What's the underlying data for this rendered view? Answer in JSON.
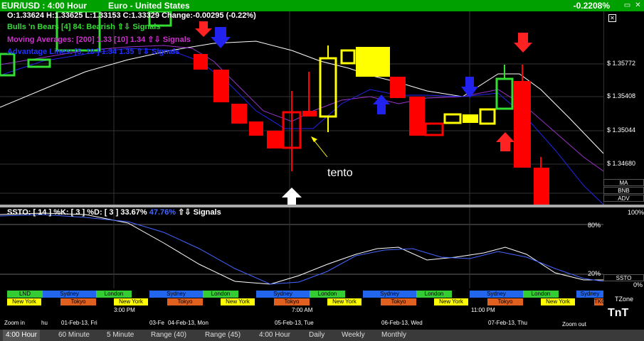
{
  "title": {
    "symbol": "EUR/USD : 4:00 Hour",
    "name": "Euro - United States",
    "change_pct": "-0.2208%"
  },
  "legend": {
    "ohlc": "O:1.33624  H:1.33625  L:1.33153  C:1.33329  Change:-0.00295 (-0.22%)",
    "bulls": "Bulls 'n Bears [4] 84:  Bearish  ⇧⇩ Signals",
    "ma": "Moving Averages: [200] 1.33  [10] 1.34  ⇧⇩ Signals",
    "adv": "Advantage Lines: [5,  10  ]  1.34  1.35  ⇧⇩ Signals"
  },
  "annotation": "tento",
  "price_ticks": [
    "$ 1.35772",
    "$ 1.35408",
    "$ 1.35044",
    "$ 1.34680"
  ],
  "side_buttons": [
    "MA",
    "BNB",
    "ADV"
  ],
  "stoch": {
    "label": "SSTO: [ 14 ] %K: [ 3 ] %D: [ 3 ]",
    "k_val": "33.67%",
    "d_val": "47.76%",
    "signals": "⇧⇩ Signals",
    "ticks": [
      "80%",
      "20%"
    ],
    "axis": [
      "100%",
      "0%"
    ],
    "btn": "SSTO"
  },
  "sessions_top": [
    "LND",
    "Sydney",
    "London",
    "Sydney",
    "London",
    "Sydney",
    "London",
    "Sydney",
    "London",
    "Sydney",
    "London",
    "Sydney"
  ],
  "sessions_bottom": [
    "New York",
    "Tokyo",
    "New York",
    "Tokyo",
    "New York",
    "Tokyo",
    "New York",
    "Tokyo",
    "New York",
    "Tokyo",
    "New York",
    "Tokyo",
    "TKO"
  ],
  "time_labels": {
    "zoom_in": "Zoom in",
    "zoom_out": "Zoom out",
    "t1": "3:00 PM",
    "t2": "7:00 AM",
    "t3": "11:00 PM",
    "d0": "hu",
    "d1": "01-Feb-13, Fri",
    "d2": "03-Fe",
    "d3": "04-Feb-13, Mon",
    "d4": "05-Feb-13, Tue",
    "d5": "06-Feb-13, Wed",
    "d6": "07-Feb-13, Thu",
    "tzone": "TZone",
    "logo": "TnT"
  },
  "tabs": [
    "4:00 Hour",
    "60 Minute",
    "5 Minute",
    "Range (40)",
    "Range (45)",
    "4:00 Hour",
    "Daily",
    "Weekly",
    "Monthly"
  ],
  "colors": {
    "green_candle": "#33dd33",
    "red_candle": "#ff0000",
    "yellow_candle": "#ffff00",
    "blue_line": "#2222ee",
    "purple_line": "#9933cc"
  }
}
